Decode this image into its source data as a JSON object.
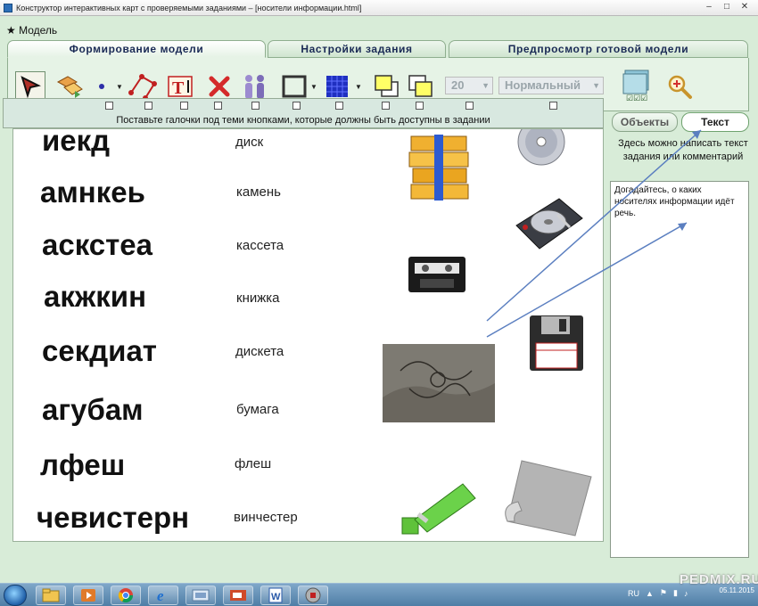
{
  "window": {
    "title": "Конструктор интерактивных карт с проверяемыми заданиями – [носители информации.html]",
    "controls": [
      "–",
      "□",
      "✕"
    ]
  },
  "menu": {
    "model_label": "Модель"
  },
  "tabs": [
    {
      "label": "Формирование модели",
      "active": true
    },
    {
      "label": "Настройки задания",
      "active": false
    },
    {
      "label": "Предпросмотр готовой модели",
      "active": false
    }
  ],
  "toolbar": {
    "tools": [
      {
        "icon": "pointer-arrow-icon",
        "selected": true
      },
      {
        "icon": "move-shapes-icon"
      },
      {
        "icon": "point-icon"
      },
      {
        "icon": "polyline-icon"
      },
      {
        "icon": "text-tool-icon"
      },
      {
        "icon": "delete-icon"
      },
      {
        "icon": "group-icon"
      },
      {
        "icon": "rectangle-outline-icon"
      },
      {
        "icon": "grid-fill-icon"
      },
      {
        "icon": "bring-front-icon"
      },
      {
        "icon": "send-back-icon"
      }
    ],
    "font_size": "20",
    "font_style": "Нормальный",
    "colors": {
      "accent": "#2e2ea8",
      "highlight": "#ffff99"
    }
  },
  "check_strip": {
    "count": 12,
    "hint": "Поставьте галочки под теми кнопками, которые должны быть доступны в задании"
  },
  "canvas": {
    "scrambled": [
      "иекд",
      "амнкеь",
      "аскстеа",
      "акжкин",
      "секдиат",
      "агубам",
      "лфеш",
      "чевистерн"
    ],
    "words": [
      "диск",
      "камень",
      "кассета",
      "книжка",
      "дискета",
      "бумага",
      "флеш",
      "винчестер"
    ],
    "images": [
      "books-icon",
      "disc-icon",
      "hard-drive-icon",
      "cassette-icon",
      "floppy-disk-icon",
      "stone-carving-icon",
      "usb-flash-icon",
      "paper-sheet-icon"
    ]
  },
  "side_panel": {
    "objects_label": "Объекты",
    "text_label": "Текст",
    "hint": "Здесь можно написать текст задания или комментарий",
    "task_text": "Догадайтесь, о каких носителях информации идёт речь."
  },
  "taskbar": {
    "apps": [
      "explorer-icon",
      "media-player-icon",
      "chrome-icon",
      "ie-icon",
      "presentation-icon",
      "impress-icon",
      "word-icon",
      "map-builder-icon"
    ],
    "lang": "RU",
    "date": "05.11.2015"
  },
  "watermark": "PEDMIX.RU"
}
